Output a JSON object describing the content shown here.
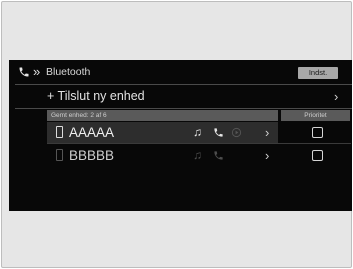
{
  "header": {
    "breadcrumb_separator": "»",
    "title": "Bluetooth",
    "settings_button": "Indst."
  },
  "connect_row": {
    "label": "+ Tilslut ny enhed",
    "chevron": "›"
  },
  "list_header": {
    "count_label": "Gemt enhed: 2 af 6",
    "priority_label": "Prioritet"
  },
  "devices": [
    {
      "name": "AAAAA",
      "chevron": "›",
      "selected": true
    },
    {
      "name": "BBBBB",
      "chevron": "›",
      "selected": false
    }
  ],
  "icons": {
    "header": "phone-icon",
    "row": [
      "phone-device-icon",
      "music-note-icon",
      "phone-icon",
      "play-icon",
      "chevron-right-icon",
      "checkbox"
    ]
  },
  "colors": {
    "screen_bg": "#080808",
    "frame_bg": "#e6e6e6",
    "selected_row": "#2d2d2d",
    "header_bar": "#5a5a5a",
    "button_bg": "#a8a8a8"
  }
}
